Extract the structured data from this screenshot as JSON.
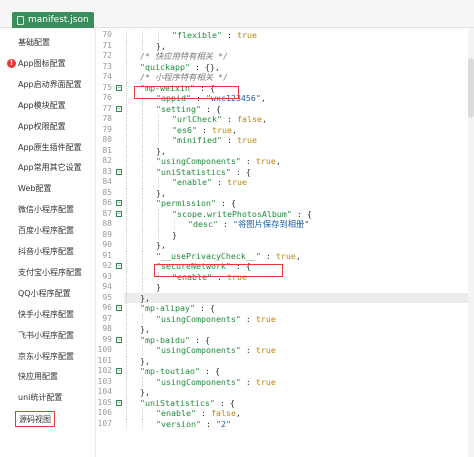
{
  "tab": {
    "label": "manifest.json"
  },
  "sidebar": {
    "items": [
      {
        "label": "基础配置",
        "error": false,
        "active": false
      },
      {
        "label": "App图标配置",
        "error": true,
        "active": false
      },
      {
        "label": "App启动界面配置",
        "error": false,
        "active": false
      },
      {
        "label": "App模块配置",
        "error": false,
        "active": false
      },
      {
        "label": "App权限配置",
        "error": false,
        "active": false
      },
      {
        "label": "App原生插件配置",
        "error": false,
        "active": false
      },
      {
        "label": "App常用其它设置",
        "error": false,
        "active": false
      },
      {
        "label": "Web配置",
        "error": false,
        "active": false
      },
      {
        "label": "微信小程序配置",
        "error": false,
        "active": false
      },
      {
        "label": "百度小程序配置",
        "error": false,
        "active": false
      },
      {
        "label": "抖音小程序配置",
        "error": false,
        "active": false
      },
      {
        "label": "支付宝小程序配置",
        "error": false,
        "active": false
      },
      {
        "label": "QQ小程序配置",
        "error": false,
        "active": false
      },
      {
        "label": "快手小程序配置",
        "error": false,
        "active": false
      },
      {
        "label": "飞书小程序配置",
        "error": false,
        "active": false
      },
      {
        "label": "京东小程序配置",
        "error": false,
        "active": false
      },
      {
        "label": "快应用配置",
        "error": false,
        "active": false
      },
      {
        "label": "uni统计配置",
        "error": false,
        "active": false
      },
      {
        "label": "源码视图",
        "error": false,
        "active": true
      }
    ]
  },
  "editor": {
    "lines": [
      {
        "n": "70",
        "indent": 3,
        "fold": false,
        "segs": [
          [
            "k",
            "\"flexible\""
          ],
          [
            "p",
            " : "
          ],
          [
            "kw",
            "true"
          ]
        ]
      },
      {
        "n": "71",
        "indent": 2,
        "fold": false,
        "segs": [
          [
            "p",
            "},"
          ]
        ]
      },
      {
        "n": "72",
        "indent": 1,
        "fold": false,
        "segs": [
          [
            "cm",
            "/* 快应用特有相关 */"
          ]
        ]
      },
      {
        "n": "73",
        "indent": 1,
        "fold": false,
        "segs": [
          [
            "k",
            "\"quickapp\""
          ],
          [
            "p",
            " : {},"
          ]
        ]
      },
      {
        "n": "74",
        "indent": 1,
        "fold": false,
        "segs": [
          [
            "cm",
            "/* 小程序特有相关 */"
          ]
        ]
      },
      {
        "n": "75",
        "indent": 1,
        "fold": true,
        "segs": [
          [
            "k",
            "\"mp-weixin\""
          ],
          [
            "p",
            " : {"
          ]
        ]
      },
      {
        "n": "76",
        "indent": 2,
        "fold": false,
        "segs": [
          [
            "k",
            "\"appid\""
          ],
          [
            "p",
            " : "
          ],
          [
            "s",
            "\"wxc123456\""
          ],
          [
            "p",
            ","
          ]
        ]
      },
      {
        "n": "77",
        "indent": 2,
        "fold": true,
        "segs": [
          [
            "k",
            "\"setting\""
          ],
          [
            "p",
            " : {"
          ]
        ]
      },
      {
        "n": "78",
        "indent": 3,
        "fold": false,
        "segs": [
          [
            "k",
            "\"urlCheck\""
          ],
          [
            "p",
            " : "
          ],
          [
            "kw",
            "false"
          ],
          [
            "p",
            ","
          ]
        ]
      },
      {
        "n": "79",
        "indent": 3,
        "fold": false,
        "segs": [
          [
            "k",
            "\"es6\""
          ],
          [
            "p",
            " : "
          ],
          [
            "kw",
            "true"
          ],
          [
            "p",
            ","
          ]
        ]
      },
      {
        "n": "80",
        "indent": 3,
        "fold": false,
        "segs": [
          [
            "k",
            "\"minified\""
          ],
          [
            "p",
            " : "
          ],
          [
            "kw",
            "true"
          ]
        ]
      },
      {
        "n": "81",
        "indent": 2,
        "fold": false,
        "segs": [
          [
            "p",
            "},"
          ]
        ]
      },
      {
        "n": "82",
        "indent": 2,
        "fold": false,
        "segs": [
          [
            "k",
            "\"usingComponents\""
          ],
          [
            "p",
            " : "
          ],
          [
            "kw",
            "true"
          ],
          [
            "p",
            ","
          ]
        ]
      },
      {
        "n": "83",
        "indent": 2,
        "fold": true,
        "segs": [
          [
            "k",
            "\"uniStatistics\""
          ],
          [
            "p",
            " : {"
          ]
        ]
      },
      {
        "n": "84",
        "indent": 3,
        "fold": false,
        "segs": [
          [
            "k",
            "\"enable\""
          ],
          [
            "p",
            " : "
          ],
          [
            "kw",
            "true"
          ]
        ]
      },
      {
        "n": "85",
        "indent": 2,
        "fold": false,
        "segs": [
          [
            "p",
            "},"
          ]
        ]
      },
      {
        "n": "86",
        "indent": 2,
        "fold": true,
        "segs": [
          [
            "k",
            "\"permission\""
          ],
          [
            "p",
            " : {"
          ]
        ]
      },
      {
        "n": "87",
        "indent": 3,
        "fold": true,
        "segs": [
          [
            "k",
            "\"scope.writePhotosAlbum\""
          ],
          [
            "p",
            " : {"
          ]
        ]
      },
      {
        "n": "88",
        "indent": 4,
        "fold": false,
        "segs": [
          [
            "k",
            "\"desc\""
          ],
          [
            "p",
            " : "
          ],
          [
            "s",
            "\"将图片保存到相册\""
          ]
        ]
      },
      {
        "n": "89",
        "indent": 3,
        "fold": false,
        "segs": [
          [
            "p",
            "}"
          ]
        ]
      },
      {
        "n": "90",
        "indent": 2,
        "fold": false,
        "segs": [
          [
            "p",
            "},"
          ]
        ]
      },
      {
        "n": "91",
        "indent": 2,
        "fold": false,
        "segs": [
          [
            "k",
            "\"__usePrivacyCheck__\""
          ],
          [
            "p",
            " : "
          ],
          [
            "kw",
            "true"
          ],
          [
            "p",
            ","
          ]
        ]
      },
      {
        "n": "92",
        "indent": 2,
        "fold": true,
        "segs": [
          [
            "k",
            "\"secureNetwork\""
          ],
          [
            "p",
            " : {"
          ]
        ]
      },
      {
        "n": "93",
        "indent": 3,
        "fold": false,
        "segs": [
          [
            "k",
            "\"enable\""
          ],
          [
            "p",
            " : "
          ],
          [
            "kw",
            "true"
          ]
        ]
      },
      {
        "n": "94",
        "indent": 2,
        "fold": false,
        "segs": [
          [
            "p",
            "}"
          ]
        ]
      },
      {
        "n": "95",
        "indent": 1,
        "fold": false,
        "hl": true,
        "segs": [
          [
            "p",
            "},"
          ]
        ]
      },
      {
        "n": "96",
        "indent": 1,
        "fold": true,
        "segs": [
          [
            "k",
            "\"mp-alipay\""
          ],
          [
            "p",
            " : {"
          ]
        ]
      },
      {
        "n": "97",
        "indent": 2,
        "fold": false,
        "segs": [
          [
            "k",
            "\"usingComponents\""
          ],
          [
            "p",
            " : "
          ],
          [
            "kw",
            "true"
          ]
        ]
      },
      {
        "n": "98",
        "indent": 1,
        "fold": false,
        "segs": [
          [
            "p",
            "},"
          ]
        ]
      },
      {
        "n": "99",
        "indent": 1,
        "fold": true,
        "segs": [
          [
            "k",
            "\"mp-baidu\""
          ],
          [
            "p",
            " : {"
          ]
        ]
      },
      {
        "n": "100",
        "indent": 2,
        "fold": false,
        "segs": [
          [
            "k",
            "\"usingComponents\""
          ],
          [
            "p",
            " : "
          ],
          [
            "kw",
            "true"
          ]
        ]
      },
      {
        "n": "101",
        "indent": 1,
        "fold": false,
        "segs": [
          [
            "p",
            "},"
          ]
        ]
      },
      {
        "n": "102",
        "indent": 1,
        "fold": true,
        "segs": [
          [
            "k",
            "\"mp-toutiao\""
          ],
          [
            "p",
            " : {"
          ]
        ]
      },
      {
        "n": "103",
        "indent": 2,
        "fold": false,
        "segs": [
          [
            "k",
            "\"usingComponents\""
          ],
          [
            "p",
            " : "
          ],
          [
            "kw",
            "true"
          ]
        ]
      },
      {
        "n": "104",
        "indent": 1,
        "fold": false,
        "segs": [
          [
            "p",
            "},"
          ]
        ]
      },
      {
        "n": "105",
        "indent": 1,
        "fold": true,
        "segs": [
          [
            "k",
            "\"uniStatistics\""
          ],
          [
            "p",
            " : {"
          ]
        ]
      },
      {
        "n": "106",
        "indent": 2,
        "fold": false,
        "segs": [
          [
            "k",
            "\"enable\""
          ],
          [
            "p",
            " : "
          ],
          [
            "kw",
            "false"
          ],
          [
            "p",
            ","
          ]
        ]
      },
      {
        "n": "107",
        "indent": 2,
        "fold": false,
        "segs": [
          [
            "k",
            "\"version\""
          ],
          [
            "p",
            " : "
          ],
          [
            "s",
            "\"2\""
          ]
        ]
      }
    ]
  },
  "colors": {
    "tab_bg": "#3a8e5c",
    "key": "#1f8a3c",
    "string": "#1f5fa8",
    "keyword": "#b8860b",
    "comment": "#7a7a7a",
    "highlight_box": "#e53935",
    "error_badge": "#e53935"
  }
}
